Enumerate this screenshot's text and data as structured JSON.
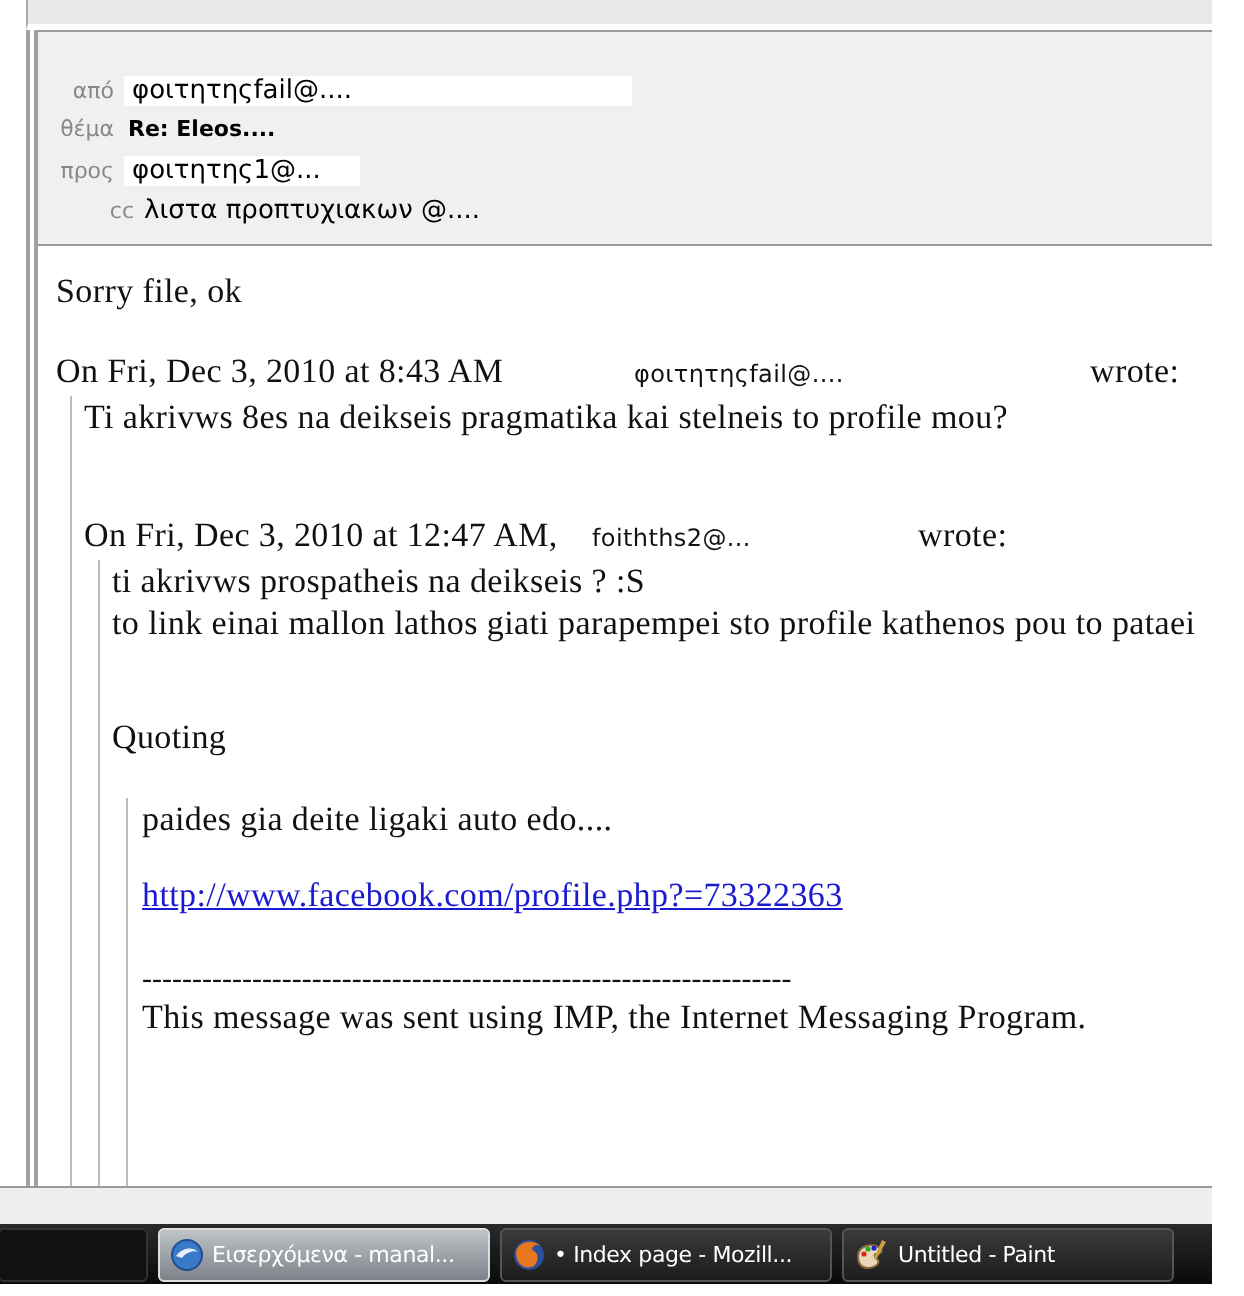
{
  "header": {
    "fields": [
      {
        "kind": "sender",
        "label": "από",
        "value": "φοιτητηςfail@...."
      },
      {
        "kind": "subject",
        "label": "θέμα",
        "value": "Re: Eleos...."
      },
      {
        "kind": "recipient",
        "label": "προς",
        "value": "φοιτητης1@..."
      },
      {
        "kind": "cc",
        "label": "cc",
        "value": "λιστα προπτυχιακων @...."
      }
    ]
  },
  "message": {
    "blocks": [
      {
        "kind": "text",
        "text": "Sorry file, ok"
      },
      {
        "kind": "attribution",
        "date": "On Fri, Dec 3, 2010 at 8:43 AM",
        "sender": "φοιτητηςfail@....",
        "wrote": "wrote:"
      },
      {
        "kind": "quote",
        "blocks": [
          {
            "kind": "text",
            "text": "Ti akrivws 8es na deikseis pragmatika kai stelneis to profile mou?"
          },
          {
            "kind": "attribution",
            "date": "On Fri, Dec 3, 2010 at 12:47 AM,",
            "sender": "foithths2@...",
            "wrote": "wrote:"
          },
          {
            "kind": "quote",
            "blocks": [
              {
                "kind": "text",
                "text": "ti akrivws prospatheis na deikseis ? :S"
              },
              {
                "kind": "text",
                "text": "to link einai mallon lathos giati parapempei sto profile kathenos pou to pataei"
              },
              {
                "kind": "heading",
                "text": "Quoting"
              },
              {
                "kind": "quote",
                "blocks": [
                  {
                    "kind": "text",
                    "text": "paides gia deite ligaki auto edo...."
                  },
                  {
                    "kind": "link",
                    "text": "http://www.facebook.com/profile.php?=73322363"
                  },
                  {
                    "kind": "separator",
                    "text": "-----------------------------------------------------------------"
                  },
                  {
                    "kind": "text",
                    "text": "This message was sent using IMP, the Internet Messaging Program."
                  }
                ]
              }
            ]
          }
        ]
      }
    ]
  },
  "taskbar": {
    "items": [
      {
        "kind": "hidden",
        "selected": false
      },
      {
        "kind": "mail",
        "label": "Εισερχόμενα - manal...",
        "selected": true
      },
      {
        "kind": "browser",
        "label": "• Index page - Mozill...",
        "selected": false
      },
      {
        "kind": "paint",
        "label": "Untitled - Paint",
        "selected": false
      }
    ]
  }
}
